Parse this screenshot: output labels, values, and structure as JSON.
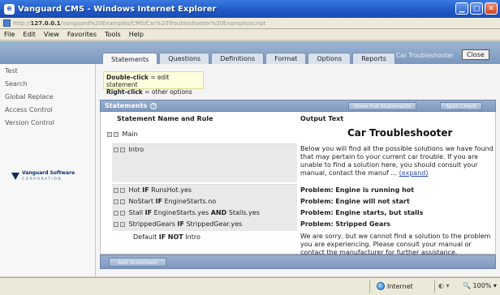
{
  "window": {
    "title": "Vanguard CMS - Windows Internet Explorer"
  },
  "address": {
    "host": "127.0.0.1",
    "path": "/vanguard%20Examples/CMS/Car%20Troubleshooter%20Example/script"
  },
  "menu": [
    "File",
    "Edit",
    "View",
    "Favorites",
    "Tools",
    "Help"
  ],
  "tabs": [
    "Statements",
    "Questions",
    "Definitions",
    "Format",
    "Options",
    "Reports"
  ],
  "top_right": {
    "app_label": "Car Troubleshooter",
    "close_label": "Close"
  },
  "sidebar": {
    "items": [
      "Test",
      "Search",
      "Global Replace",
      "Access Control",
      "Version Control"
    ],
    "logo": {
      "name": "Vanguard Software",
      "sub": "CORPORATION"
    }
  },
  "hint": {
    "line1_bold": "Double-click",
    "line1_rest": " = edit statement",
    "line2_bold": "Right-click",
    "line2_rest": " = other options"
  },
  "statements": {
    "header": "Statements",
    "show_full_button": "Show Full Statements",
    "spell_check_button": "Spell Check",
    "col_name": "Statement Name and Rule",
    "col_output": "Output Text",
    "main_label": "Main",
    "main_output_title": "Car Troubleshooter",
    "intro_label": "Intro",
    "intro_output": "Below you will find all the possible solutions we have found that may pertain to your current car trouble. If you are unable to find a solution here, you should consult your manual, contact the manuf ...",
    "expand_link": "(expand)",
    "rows": [
      {
        "name": "Hot",
        "kw1": "IF",
        "cond": "RunsHot.yes",
        "kw2": "",
        "cond2": "",
        "problem": "Problem:",
        "output": "Engine is running hot"
      },
      {
        "name": "NoStart",
        "kw1": "IF",
        "cond": "EngineStarts.no",
        "kw2": "",
        "cond2": "",
        "problem": "Problem:",
        "output": "Engine will not start"
      },
      {
        "name": "Stall",
        "kw1": "IF",
        "cond": "EngineStarts.yes",
        "kw2": "AND",
        "cond2": "Stalls.yes",
        "problem": "Problem:",
        "output": "Engine starts, but stalls"
      },
      {
        "name": "StrippedGears",
        "kw1": "IF",
        "cond": "StrippedGear.yes",
        "kw2": "",
        "cond2": "",
        "problem": "Problem:",
        "output": "Stripped Gears"
      }
    ],
    "default_row": {
      "name": "Default",
      "kw1": "IF",
      "kw2": "NOT",
      "cond": "Intro",
      "output": "We are sorry, but we cannot find a solution to the problem you are experiencing.  Please consult your manual or contact the manufacturer for further assistance."
    },
    "add_button": "Add Statement"
  },
  "status": {
    "zone": "Internet",
    "zoom": "100%"
  },
  "colors": {
    "titlebar": "#1f58c7",
    "header": "#8aa2c7",
    "hint_bg": "#ffffe0"
  },
  "icons": [
    "ie-icon",
    "minimize-icon",
    "maximize-icon",
    "close-icon",
    "page-icon",
    "help-circle-icon",
    "expand-plus-icon",
    "globe-icon"
  ]
}
